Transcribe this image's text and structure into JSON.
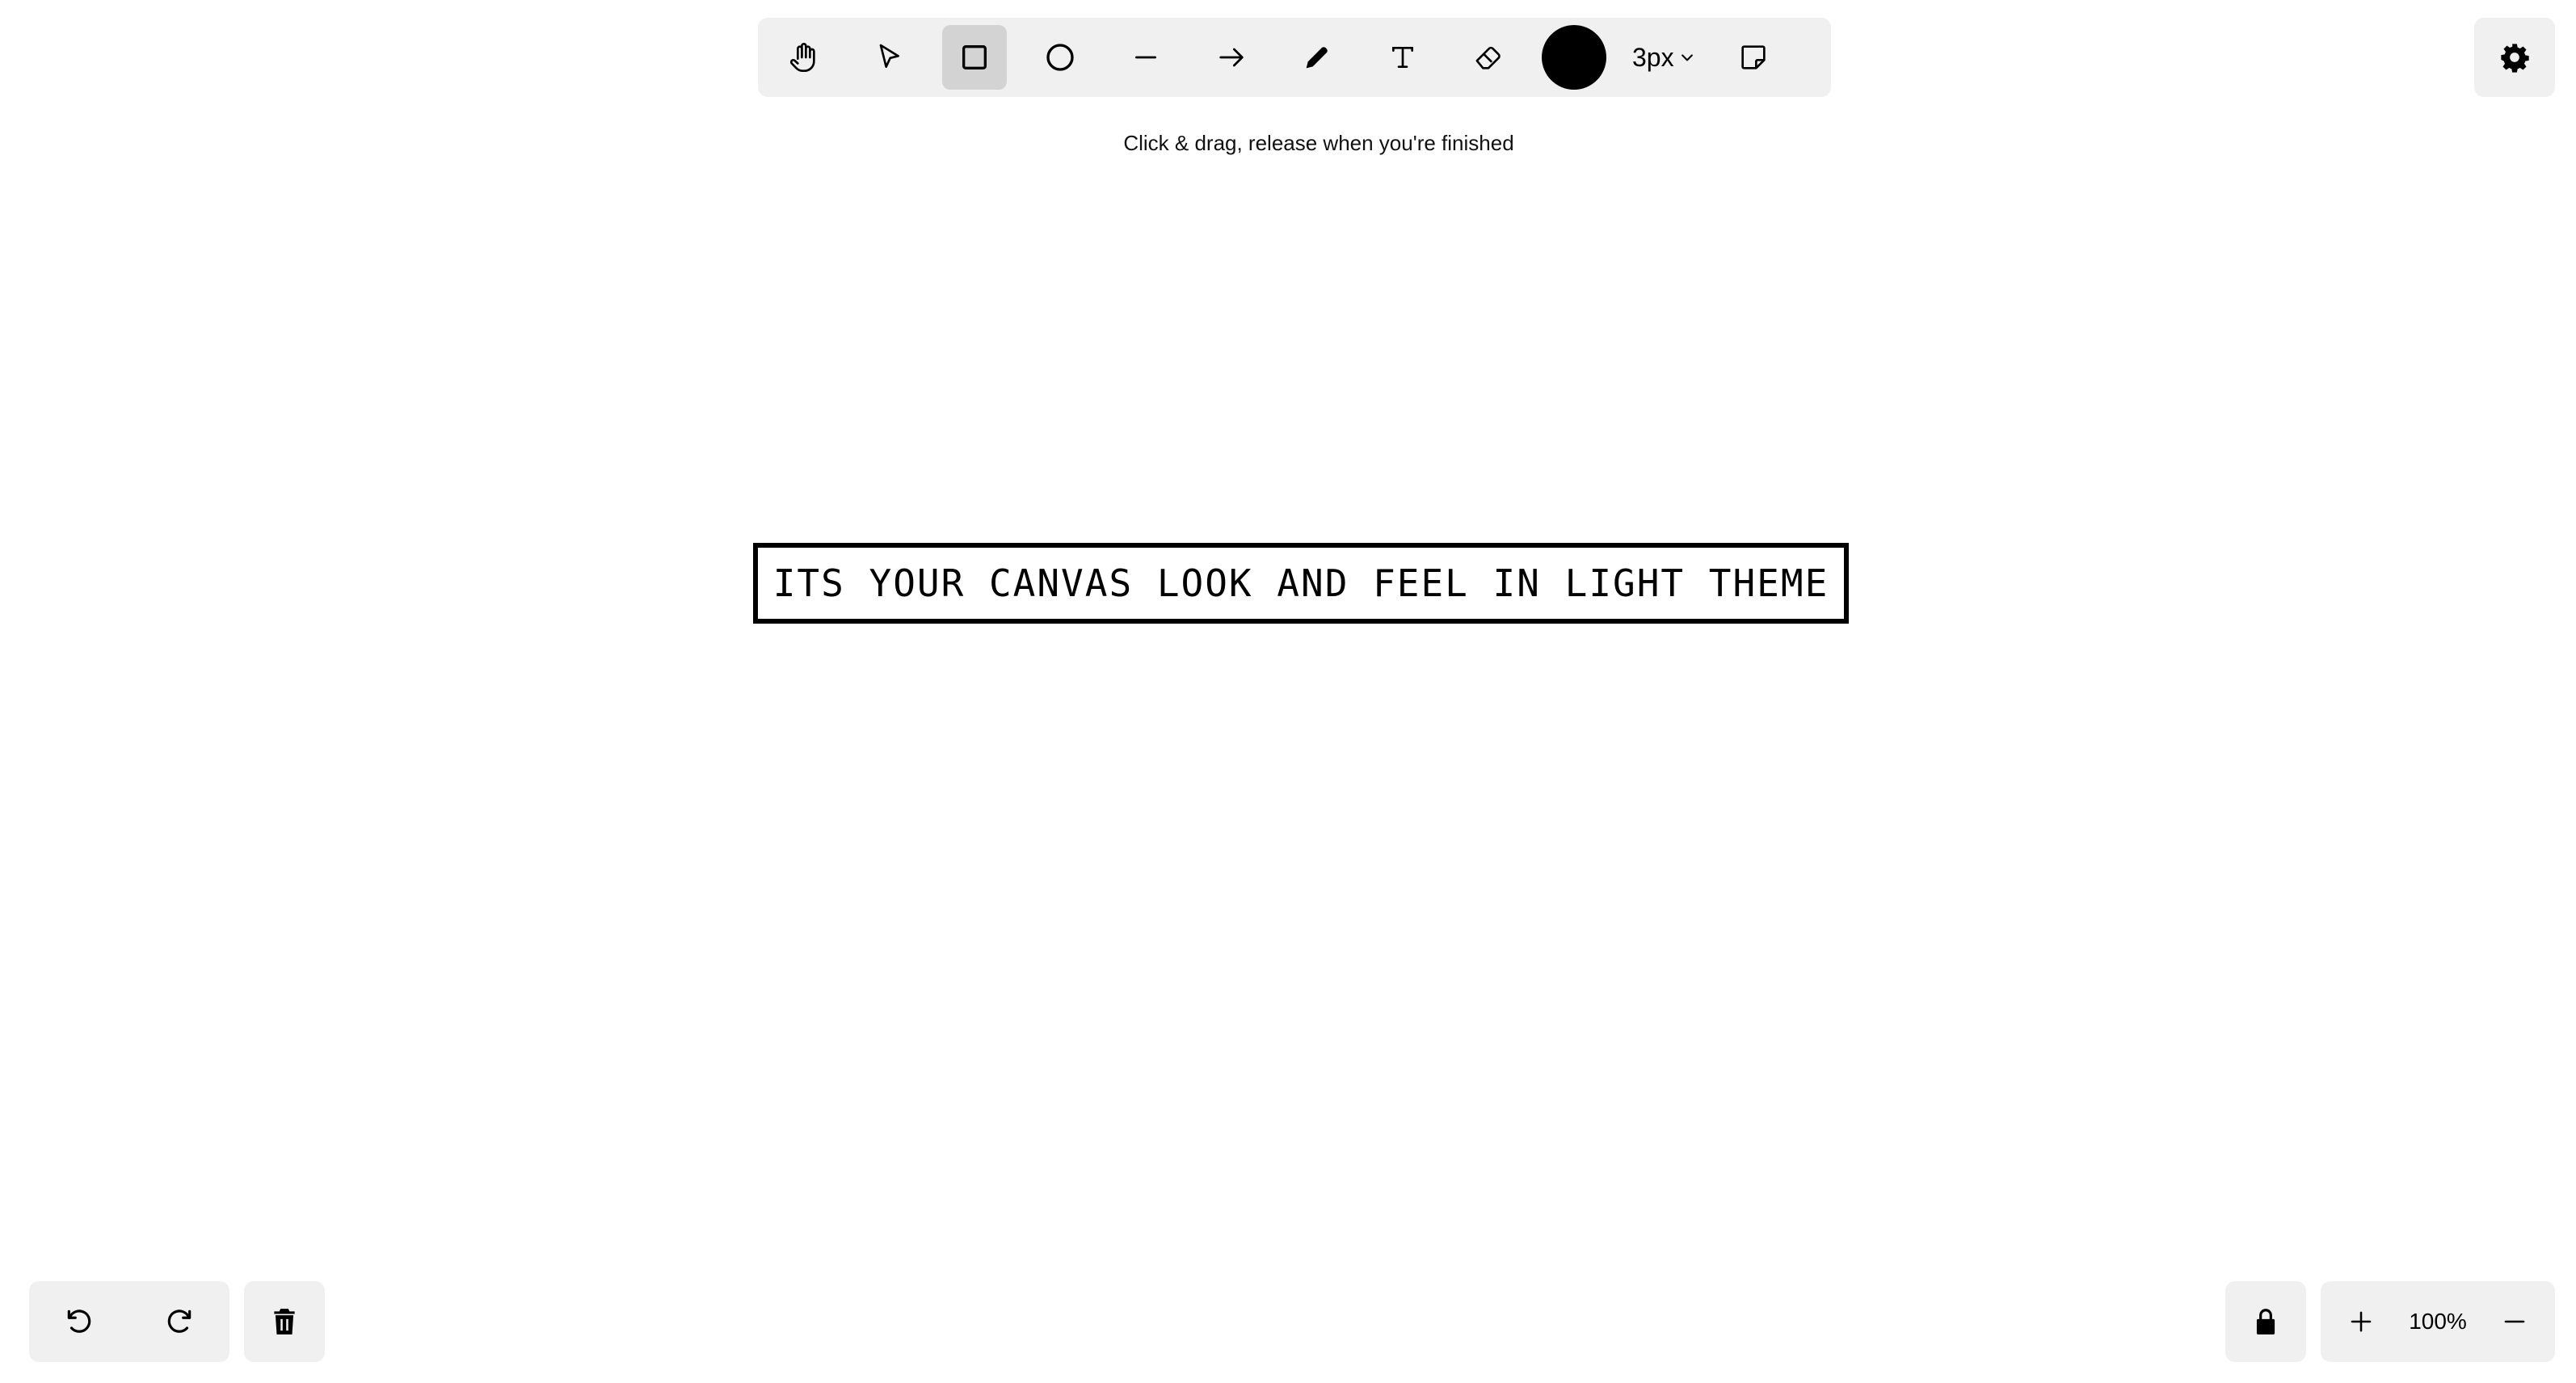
{
  "toolbar": {
    "tools": [
      {
        "name": "hand",
        "icon": "hand-icon",
        "active": false
      },
      {
        "name": "select",
        "icon": "pointer-icon",
        "active": false
      },
      {
        "name": "rectangle",
        "icon": "rectangle-icon",
        "active": true
      },
      {
        "name": "ellipse",
        "icon": "circle-icon",
        "active": false
      },
      {
        "name": "line",
        "icon": "line-icon",
        "active": false
      },
      {
        "name": "arrow",
        "icon": "arrow-icon",
        "active": false
      },
      {
        "name": "pencil",
        "icon": "pencil-icon",
        "active": false
      },
      {
        "name": "text",
        "icon": "text-icon",
        "active": false
      },
      {
        "name": "eraser",
        "icon": "eraser-icon",
        "active": false
      }
    ],
    "stroke_color": "#000000",
    "stroke_size": "3px",
    "sticky_note_icon": "sticky-note-icon"
  },
  "hint": "Click & drag, release when you're finished",
  "settings_icon": "gear-icon",
  "canvas": {
    "text": "ITS YOUR CANVAS LOOK AND FEEL IN LIGHT THEME"
  },
  "bottom_left": {
    "undo_icon": "undo-icon",
    "redo_icon": "redo-icon",
    "trash_icon": "trash-icon"
  },
  "bottom_right": {
    "lock_icon": "lock-icon",
    "zoom_in_icon": "plus-icon",
    "zoom_level": "100%",
    "zoom_out_icon": "minus-icon"
  },
  "colors": {
    "panel_bg": "#f0f0f0",
    "active_tool_bg": "#d3d3d3",
    "canvas_bg": "#ffffff"
  }
}
